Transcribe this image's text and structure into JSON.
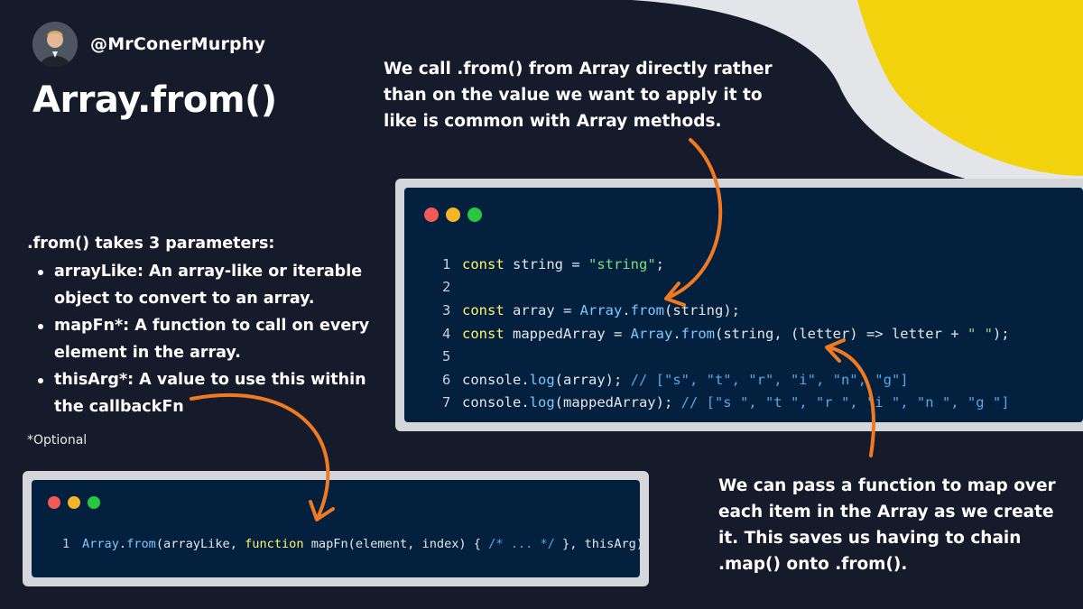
{
  "author": {
    "handle": "@MrConerMurphy"
  },
  "title": "Array.from()",
  "top_note": "We call .from() from Array directly rather than on the value  we want to apply it to like is common with Array methods.",
  "params": {
    "intro": ".from() takes 3 parameters:",
    "items": [
      {
        "name": "arrayLike",
        "desc": ": An array-like or iterable object to convert to an array."
      },
      {
        "name": "mapFn*",
        "desc": ": A function to call on every element in the array."
      },
      {
        "name": "thisArg*",
        "desc": ": A value to use this within the callbackFn"
      }
    ]
  },
  "optional_note": "*Optional",
  "main_code": {
    "lines": [
      {
        "n": "1",
        "t": [
          [
            "kw",
            "const "
          ],
          [
            "p",
            "string = "
          ],
          [
            "str",
            "\"string\""
          ],
          [
            "p",
            ";"
          ]
        ]
      },
      {
        "n": "2",
        "t": []
      },
      {
        "n": "3",
        "t": [
          [
            "kw",
            "const "
          ],
          [
            "p",
            "array = "
          ],
          [
            "fn",
            "Array"
          ],
          [
            "p",
            "."
          ],
          [
            "fn",
            "from"
          ],
          [
            "p",
            "(string);"
          ]
        ]
      },
      {
        "n": "4",
        "t": [
          [
            "kw",
            "const "
          ],
          [
            "p",
            "mappedArray = "
          ],
          [
            "fn",
            "Array"
          ],
          [
            "p",
            "."
          ],
          [
            "fn",
            "from"
          ],
          [
            "p",
            "(string, (letter) => letter + "
          ],
          [
            "str",
            "\" \""
          ],
          [
            "p",
            ");"
          ]
        ]
      },
      {
        "n": "5",
        "t": []
      },
      {
        "n": "6",
        "t": [
          [
            "p",
            "console."
          ],
          [
            "fn",
            "log"
          ],
          [
            "p",
            "(array); "
          ],
          [
            "cm",
            "// [\"s\", \"t\", \"r\", \"i\", \"n\", \"g\"]"
          ]
        ]
      },
      {
        "n": "7",
        "t": [
          [
            "p",
            "console."
          ],
          [
            "fn",
            "log"
          ],
          [
            "p",
            "(mappedArray); "
          ],
          [
            "cm",
            "// [\"s \", \"t \", \"r \", \"i \", \"n \", \"g \"]"
          ]
        ]
      }
    ]
  },
  "syntax_code": {
    "lines": [
      {
        "n": "1",
        "t": [
          [
            "fn",
            "Array"
          ],
          [
            "p",
            "."
          ],
          [
            "fn",
            "from"
          ],
          [
            "p",
            "(arrayLike, "
          ],
          [
            "kw",
            "function "
          ],
          [
            "p",
            "mapFn(element, index) { "
          ],
          [
            "cm",
            "/* ... */"
          ],
          [
            "p",
            " }, thisArg)"
          ]
        ]
      }
    ]
  },
  "bottom_note": "We can pass a function to map over each item in the Array as we create it. This saves us having to chain .map() onto .from().",
  "colors": {
    "background": "#161b2b",
    "accent_yellow": "#f2d30d",
    "light_shape": "#e4e5e9",
    "arrow_orange": "#f07a22",
    "code_bg": "#03203f",
    "dot_red": "#f25a55",
    "dot_yellow": "#f5b526",
    "dot_green": "#27c840"
  },
  "icons": {
    "window_controls": "traffic-light-dots-icon",
    "arrows": "curved-arrow-icon"
  }
}
